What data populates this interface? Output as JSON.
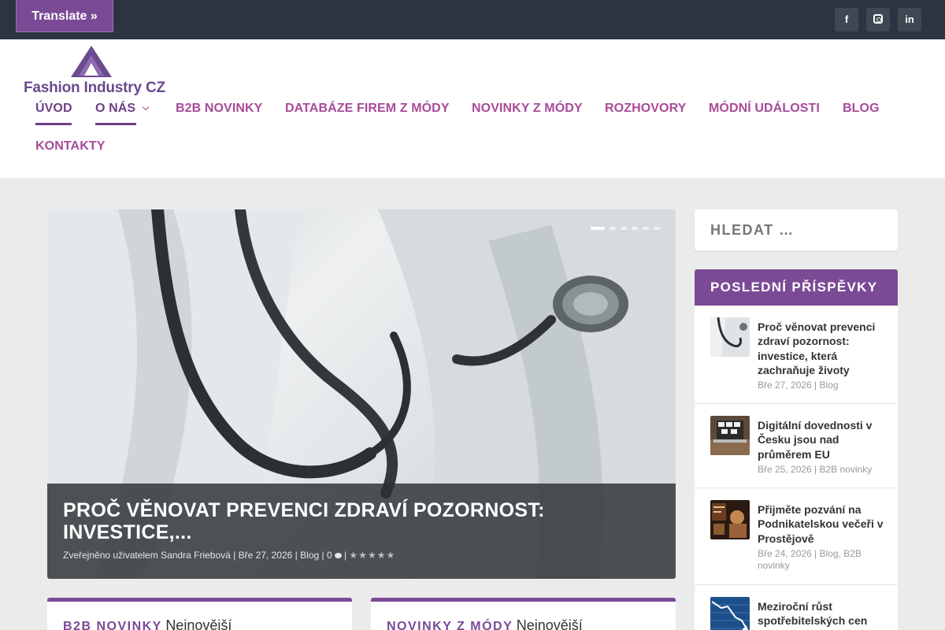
{
  "topbar": {
    "translate_label": "Translate »",
    "social": [
      {
        "name": "facebook",
        "icon": "facebook-icon",
        "glyph": "f"
      },
      {
        "name": "instagram",
        "icon": "instagram-icon"
      },
      {
        "name": "linkedin",
        "icon": "linkedin-icon",
        "glyph": "in"
      }
    ]
  },
  "header": {
    "logo_text": "Fashion Industry CZ",
    "nav": [
      {
        "label": "ÚVOD",
        "active": true
      },
      {
        "label": "O NÁS",
        "active": true,
        "dropdown": true
      },
      {
        "label": "B2B NOVINKY"
      },
      {
        "label": "DATABÁZE FIREM Z MÓDY"
      },
      {
        "label": "NOVINKY Z MÓDY"
      },
      {
        "label": "ROZHOVORY"
      },
      {
        "label": "MÓDNÍ UDÁLOSTI"
      },
      {
        "label": "BLOG"
      },
      {
        "label": "KONTAKTY"
      }
    ]
  },
  "slider": {
    "slide_count": 6,
    "active_slide": 1,
    "title": "PROČ VĚNOVAT PREVENCI ZDRAVÍ POZORNOST: INVESTICE,...",
    "meta": {
      "author_prefix": "Zveřejněno uživatelem",
      "author": "Sandra Friebová",
      "date": "Bře 27, 2026",
      "category": "Blog",
      "comments": "0",
      "rating_stars": "★★★★★"
    }
  },
  "cards": [
    {
      "category": "B2B NOVINKY",
      "subtitle": "Nejnovější"
    },
    {
      "category": "NOVINKY Z MÓDY",
      "subtitle": "Nejnovější"
    }
  ],
  "sidebar": {
    "search_placeholder": "HLEDAT …",
    "recent_title": "POSLEDNÍ PŘÍSPĚVKY",
    "posts": [
      {
        "title": "Proč věnovat prevenci zdraví pozornost: investice, která zachraňuje životy",
        "meta": "Bře 27, 2026 | Blog"
      },
      {
        "title": "Digitální dovednosti v Česku jsou nad průměrem EU",
        "meta": "Bře 25, 2026 | B2B novinky"
      },
      {
        "title": "Přijměte pozvání na Podnikatelskou večeři v Prostějově",
        "meta": "Bře 24, 2026 | Blog, B2B novinky"
      },
      {
        "title": "Meziroční růst spotřebitelských cen",
        "meta": ""
      }
    ]
  },
  "colors": {
    "topbar": "#2b3440",
    "accent_purple": "#7b4a95",
    "nav_pink": "#a94a98",
    "nav_active": "#6e3f87"
  }
}
